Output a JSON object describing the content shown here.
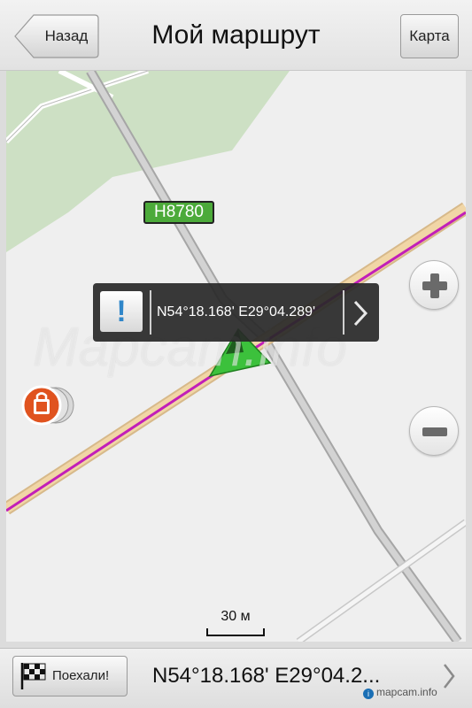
{
  "header": {
    "back_label": "Назад",
    "title": "Мой маршрут",
    "map_label": "Карта"
  },
  "map": {
    "road_label": "H8780",
    "watermark": "Mapcam.info",
    "popup": {
      "alert_icon": "!",
      "coordinates": "N54°18.168' E29°04.289'",
      "chevron": "chevron-right-icon"
    },
    "zoom_in_icon": "plus-icon",
    "zoom_out_icon": "minus-icon",
    "poi_icon": "shopping-bag-icon",
    "scale_label": "30 м",
    "colors": {
      "route": "#c21fb8",
      "main_road": "#f1d6a6",
      "park": "#cde0c4",
      "vehicle_arrow": "#3cc13c",
      "road_label_bg": "#4caa3a"
    }
  },
  "bottom": {
    "go_label": "Поехали!",
    "go_icon": "checkered-flag-icon",
    "coordinates": "N54°18.168' E29°04.2...",
    "brand": "mapcam.info"
  }
}
